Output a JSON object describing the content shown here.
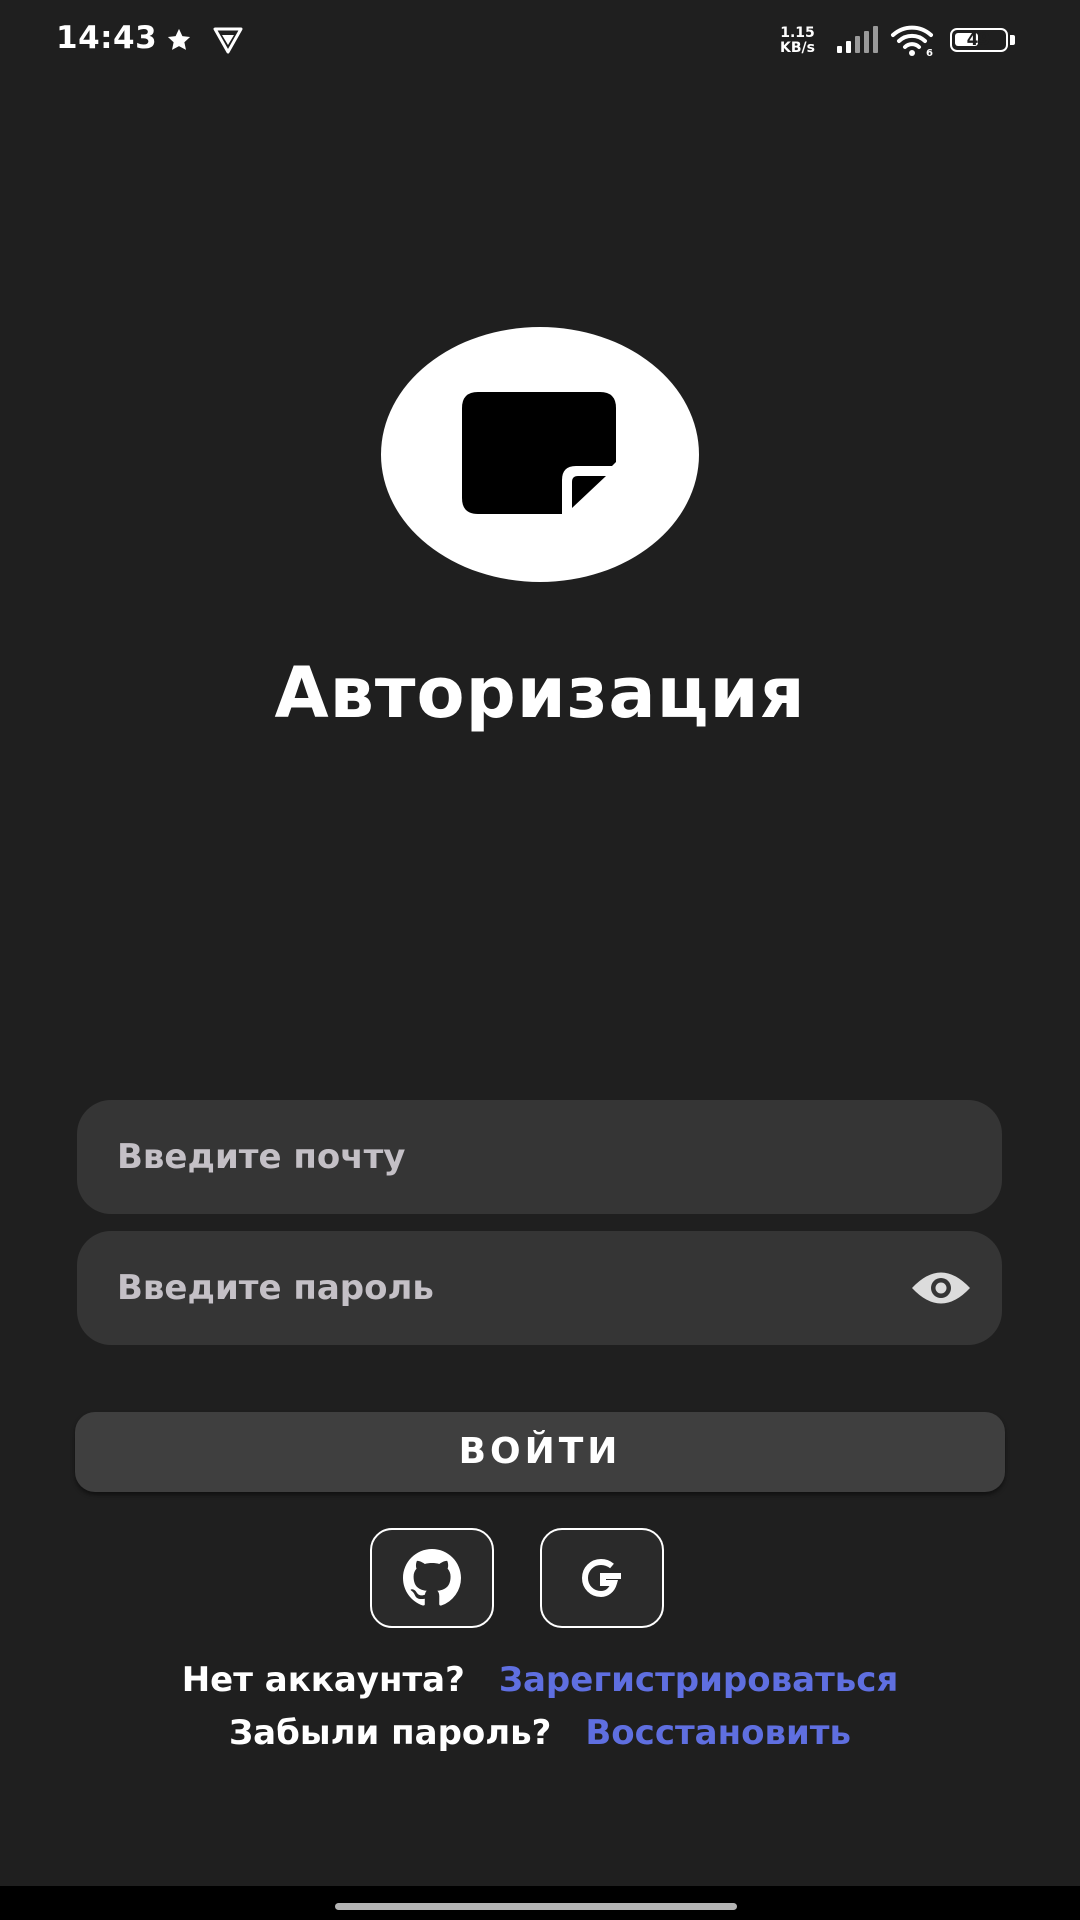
{
  "status_bar": {
    "time": "14:43",
    "net_speed_value": "1.15",
    "net_speed_unit": "KB/s",
    "battery": "49",
    "battery_level": 0.49,
    "icons": [
      "star-icon",
      "vpn-icon",
      "signal-icon",
      "wifi-icon",
      "battery-icon"
    ]
  },
  "logo": {
    "icon": "sticky-note-icon"
  },
  "title": "Авторизация",
  "form": {
    "email_placeholder": "Введите почту",
    "password_placeholder": "Введите пароль",
    "password_toggle_icon": "eye-icon",
    "login_label": "ВОЙТИ"
  },
  "social": {
    "buttons": [
      "github-icon",
      "google-icon"
    ]
  },
  "links": {
    "no_account_label": "Нет аккаунта?",
    "register_label": "Зарегистрироваться",
    "forgot_label": "Забыли пароль?",
    "recover_label": "Восстановить"
  },
  "colors": {
    "background": "#1f1f1f",
    "input_bg": "#353535",
    "button_bg": "#3f3f3f",
    "link": "#5f6fe0",
    "text": "#ffffff"
  }
}
